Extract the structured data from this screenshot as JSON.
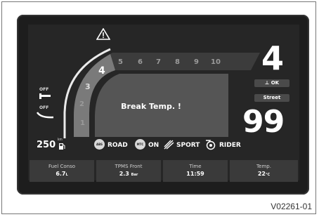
{
  "dashboard": {
    "warning_message": "Break Temp. !",
    "gear": "4",
    "status_ok": "OK",
    "riding_mode": "Street",
    "speed": "99",
    "range_value": "250",
    "range_unit": "km",
    "tach_ticks": [
      "1",
      "2",
      "3",
      "4",
      "5",
      "6",
      "7",
      "8",
      "9",
      "10"
    ],
    "left_indicators": {
      "top": "OFF",
      "bottom": "OFF"
    },
    "modes": {
      "abs_badge": "ABS",
      "abs_value": "ROAD",
      "mtc_badge": "MTC",
      "mtc_value": "ON",
      "power_value": "SPORT",
      "rider_value": "RIDER"
    }
  },
  "info_bar": [
    {
      "label": "Fuel Conso",
      "value": "6.7",
      "unit": "L"
    },
    {
      "label": "TPMS Front",
      "value": "2.3",
      "unit": "Bar"
    },
    {
      "label": "Time",
      "value": "11:59",
      "unit": ""
    },
    {
      "label": "Temp.",
      "value": "22",
      "unit": "°C"
    }
  ],
  "reference_code": "V02261-01",
  "colors": {
    "screen": "#262626",
    "body": "#1d1d1d",
    "text": "#ffffff",
    "dim": "#9a9a9a"
  },
  "icons": [
    "warning-triangle-icon",
    "fuel-pump-icon",
    "side-stand-icon",
    "lean-angle-icon",
    "power-mode-icon",
    "rider-mode-icon",
    "ok-check-icon"
  ]
}
